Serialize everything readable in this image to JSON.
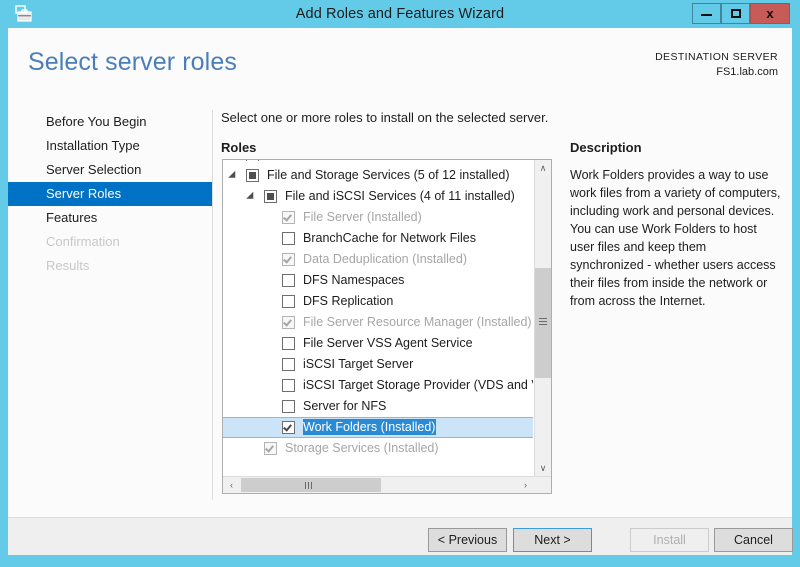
{
  "window": {
    "title": "Add Roles and Features Wizard",
    "icon": "server-wizard-icon",
    "minimize_label": "Minimize",
    "maximize_label": "Maximize",
    "close_label": "x"
  },
  "header": {
    "page_title": "Select server roles",
    "destination_label": "DESTINATION SERVER",
    "destination_server": "FS1.lab.com"
  },
  "sidebar": {
    "items": [
      {
        "label": "Before You Begin",
        "state": "normal"
      },
      {
        "label": "Installation Type",
        "state": "normal"
      },
      {
        "label": "Server Selection",
        "state": "normal"
      },
      {
        "label": "Server Roles",
        "state": "selected"
      },
      {
        "label": "Features",
        "state": "normal"
      },
      {
        "label": "Confirmation",
        "state": "disabled"
      },
      {
        "label": "Results",
        "state": "disabled"
      }
    ]
  },
  "main": {
    "instruction": "Select one or more roles to install on the selected server.",
    "roles_label": "Roles",
    "tree": [
      {
        "label": "",
        "level": 0,
        "expander": false,
        "checkbox": "none",
        "installed": false,
        "selected": false,
        "partial_top": true
      },
      {
        "label": "File and Storage Services (5 of 12 installed)",
        "level": 0,
        "expander": true,
        "checkbox": "indeterminate",
        "installed": false,
        "selected": false
      },
      {
        "label": "File and iSCSI Services (4 of 11 installed)",
        "level": 1,
        "expander": true,
        "checkbox": "indeterminate",
        "installed": false,
        "selected": false
      },
      {
        "label": "File Server (Installed)",
        "level": 2,
        "expander": false,
        "checkbox": "checked",
        "installed": true,
        "selected": false
      },
      {
        "label": "BranchCache for Network Files",
        "level": 2,
        "expander": false,
        "checkbox": "unchecked",
        "installed": false,
        "selected": false
      },
      {
        "label": "Data Deduplication (Installed)",
        "level": 2,
        "expander": false,
        "checkbox": "checked",
        "installed": true,
        "selected": false
      },
      {
        "label": "DFS Namespaces",
        "level": 2,
        "expander": false,
        "checkbox": "unchecked",
        "installed": false,
        "selected": false
      },
      {
        "label": "DFS Replication",
        "level": 2,
        "expander": false,
        "checkbox": "unchecked",
        "installed": false,
        "selected": false
      },
      {
        "label": "File Server Resource Manager (Installed)",
        "level": 2,
        "expander": false,
        "checkbox": "checked",
        "installed": true,
        "selected": false
      },
      {
        "label": "File Server VSS Agent Service",
        "level": 2,
        "expander": false,
        "checkbox": "unchecked",
        "installed": false,
        "selected": false
      },
      {
        "label": "iSCSI Target Server",
        "level": 2,
        "expander": false,
        "checkbox": "unchecked",
        "installed": false,
        "selected": false
      },
      {
        "label": "iSCSI Target Storage Provider (VDS and VSS",
        "level": 2,
        "expander": false,
        "checkbox": "unchecked",
        "installed": false,
        "selected": false
      },
      {
        "label": "Server for NFS",
        "level": 2,
        "expander": false,
        "checkbox": "unchecked",
        "installed": false,
        "selected": false
      },
      {
        "label": "Work Folders (Installed)",
        "level": 2,
        "expander": false,
        "checkbox": "checked",
        "installed": false,
        "selected": true
      },
      {
        "label": "Storage Services (Installed)",
        "level": 1,
        "expander": false,
        "checkbox": "checked",
        "installed": true,
        "selected": false
      }
    ],
    "scrollbars": {
      "vertical_up": "∧",
      "vertical_down": "∨",
      "horizontal_left": "‹",
      "horizontal_right": "›"
    }
  },
  "description": {
    "title": "Description",
    "body": "Work Folders provides a way to use work files from a variety of computers, including work and personal devices. You can use Work Folders to host user files and keep them synchronized - whether users access their files from inside the network or from across the Internet."
  },
  "footer": {
    "previous": "< Previous",
    "next": "Next >",
    "install": "Install",
    "cancel": "Cancel"
  },
  "colors": {
    "titlebar": "#63cbe8",
    "accent_blue": "#0072c6",
    "title_text_blue": "#4a7ebb",
    "close_red": "#c75b57",
    "selection_blue": "#2a8ad4",
    "row_highlight": "#cce4f7"
  }
}
